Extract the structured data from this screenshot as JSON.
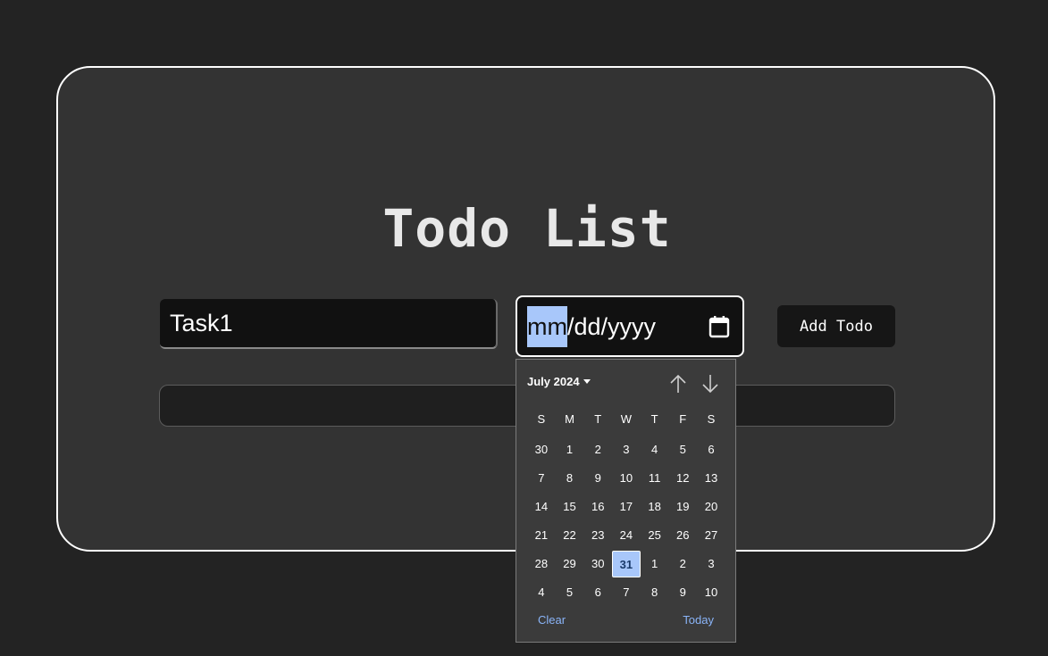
{
  "title": "Todo List",
  "task_input": {
    "value": "Task1"
  },
  "date_input": {
    "segment_month": "mm",
    "rest": "/dd/yyyy"
  },
  "add_button": "Add Todo",
  "picker": {
    "month_label": "July 2024",
    "weekdays": [
      "S",
      "M",
      "T",
      "W",
      "T",
      "F",
      "S"
    ],
    "weeks": [
      [
        "30",
        "1",
        "2",
        "3",
        "4",
        "5",
        "6"
      ],
      [
        "7",
        "8",
        "9",
        "10",
        "11",
        "12",
        "13"
      ],
      [
        "14",
        "15",
        "16",
        "17",
        "18",
        "19",
        "20"
      ],
      [
        "21",
        "22",
        "23",
        "24",
        "25",
        "26",
        "27"
      ],
      [
        "28",
        "29",
        "30",
        "31",
        "1",
        "2",
        "3"
      ],
      [
        "4",
        "5",
        "6",
        "7",
        "8",
        "9",
        "10"
      ]
    ],
    "selected_day": "31",
    "clear_label": "Clear",
    "today_label": "Today"
  },
  "colors": {
    "page_bg": "#232323",
    "card_bg": "#333333",
    "accent": "#a8c7fa",
    "link": "#8ab4f8"
  },
  "icons": {
    "calendar": "calendar-icon",
    "prev": "arrow-up-icon",
    "next": "arrow-down-icon",
    "month_menu": "caret-down-icon"
  }
}
